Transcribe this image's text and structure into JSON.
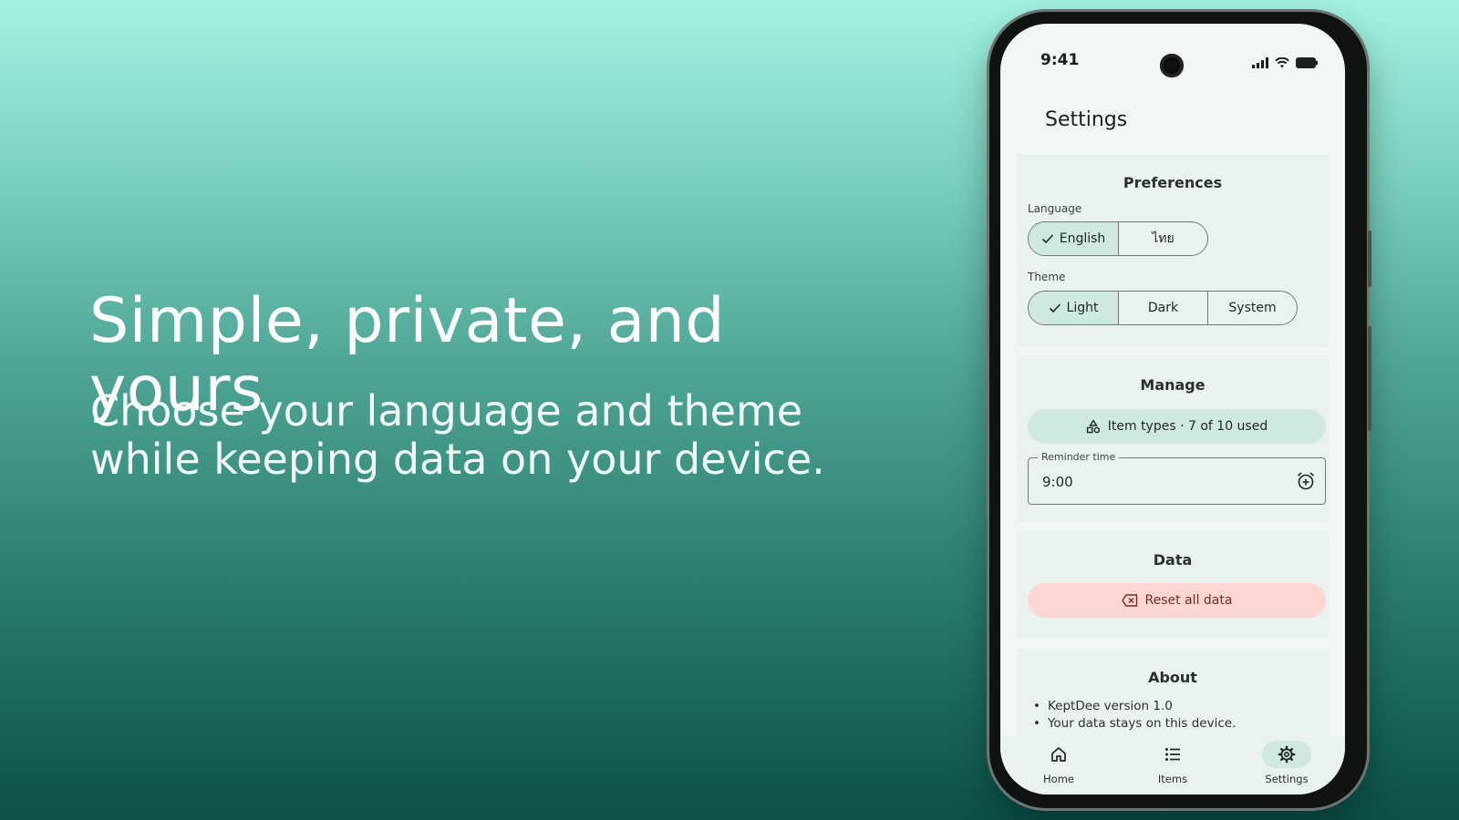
{
  "marketing": {
    "headline": "Simple, private, and yours",
    "subline_1": "Choose your language and theme",
    "subline_2": "while keeping data on your device."
  },
  "status_bar": {
    "time": "9:41"
  },
  "app": {
    "title": "Settings"
  },
  "preferences": {
    "title": "Preferences",
    "language_label": "Language",
    "language_options": [
      "English",
      "ไทย"
    ],
    "language_selected": "English",
    "theme_label": "Theme",
    "theme_options": [
      "Light",
      "Dark",
      "System"
    ],
    "theme_selected": "Light"
  },
  "manage": {
    "title": "Manage",
    "item_types_label": "Item types · 7 of 10 used",
    "reminder_label": "Reminder time",
    "reminder_value": "9:00"
  },
  "data_section": {
    "title": "Data",
    "reset_label": "Reset all data"
  },
  "about": {
    "title": "About",
    "lines": [
      "KeptDee version 1.0",
      "Your data stays on this device."
    ]
  },
  "bottom_nav": {
    "items": [
      "Home",
      "Items",
      "Settings"
    ],
    "active": "Settings"
  },
  "icons": {
    "check": "check-icon",
    "category": "category-icon",
    "alarm_add": "alarm-add-icon",
    "backspace": "backspace-icon",
    "home": "home-icon",
    "list": "list-icon",
    "gear": "gear-icon",
    "signal": "signal-icon",
    "wifi": "wifi-icon",
    "battery": "battery-icon"
  },
  "colors": {
    "accent_container": "#cfe9e1",
    "danger_container": "#fcd6d0",
    "danger_text": "#7a2b26",
    "surface": "#eaf2ef"
  }
}
